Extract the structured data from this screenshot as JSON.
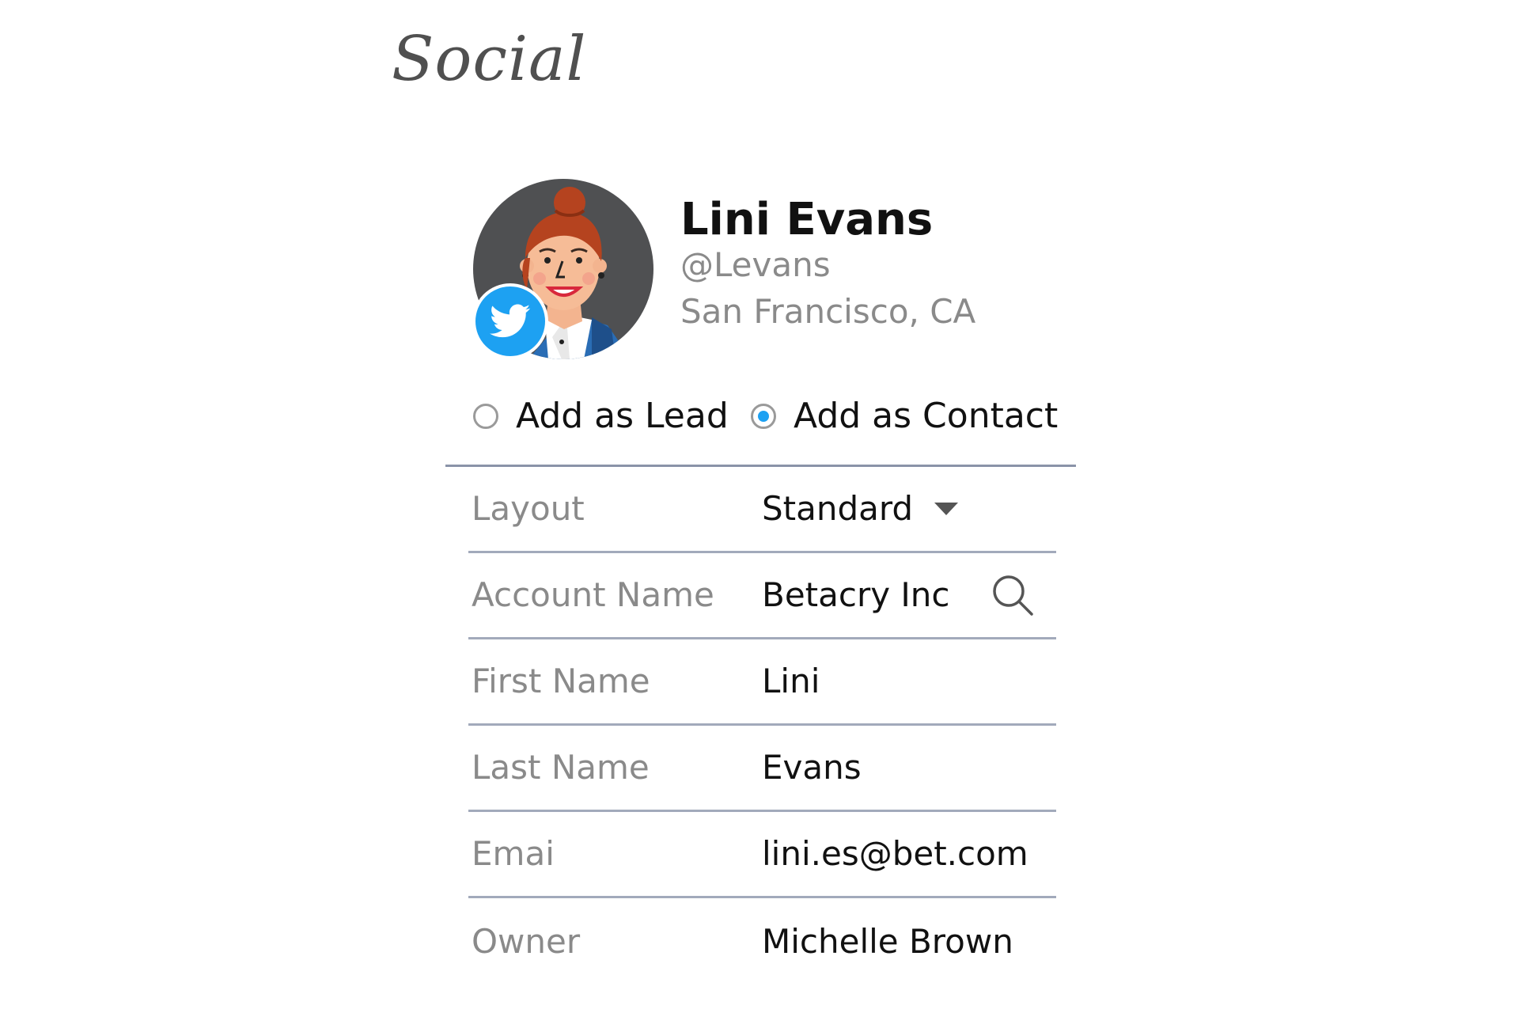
{
  "section_title": "Social",
  "profile": {
    "name": "Lini Evans",
    "handle": "@Levans",
    "location": "San Francisco, CA",
    "avatar_icon": "avatar-illustration-woman",
    "badge_icon": "twitter-bird-icon",
    "badge_color": "#1da1f2"
  },
  "add_options": {
    "lead_label": "Add as Lead",
    "contact_label": "Add as Contact",
    "selected": "contact"
  },
  "form": {
    "layout": {
      "label": "Layout",
      "value": "Standard",
      "icon": "chevron-down-icon"
    },
    "account_name": {
      "label": "Account Name",
      "value": "Betacry Inc",
      "icon": "search-icon"
    },
    "first_name": {
      "label": "First Name",
      "value": "Lini"
    },
    "last_name": {
      "label": "Last Name",
      "value": "Evans"
    },
    "email": {
      "label": "Emai",
      "value": "lini.es@bet.com"
    },
    "owner": {
      "label": "Owner",
      "value": "Michelle Brown"
    }
  }
}
